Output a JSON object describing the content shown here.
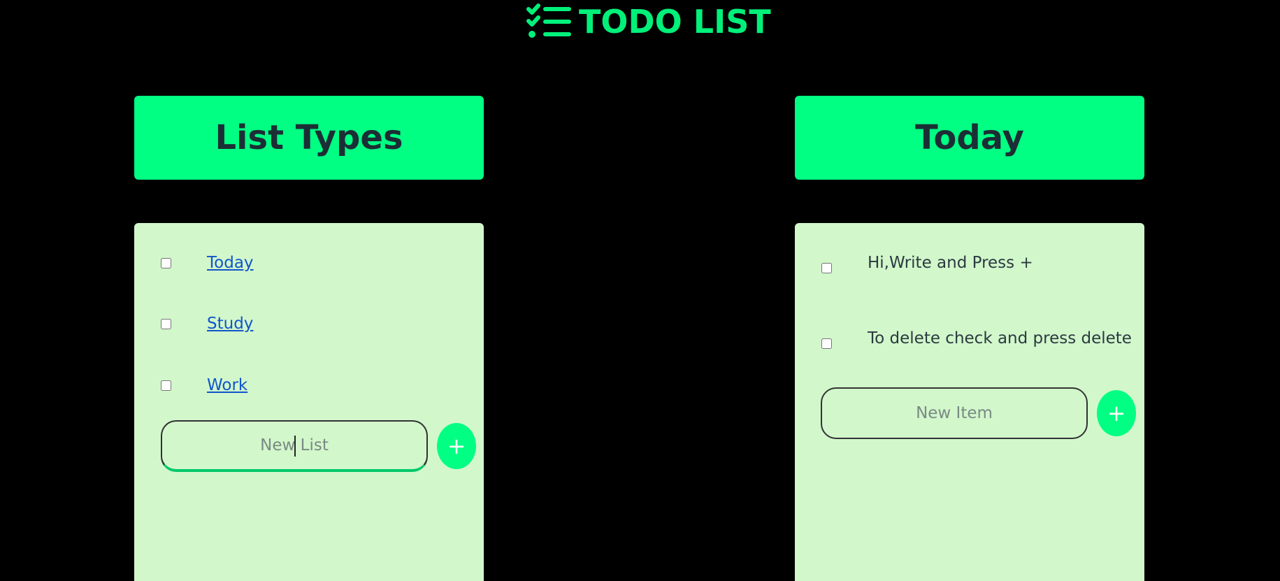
{
  "app": {
    "title": "TODO LIST",
    "brand_icon": "checklist-icon",
    "accent_color": "#00ff83",
    "background_color": "#000000",
    "panel_color": "#d2f7cb"
  },
  "list_types": {
    "heading": "List Types",
    "items": [
      {
        "label": "Today",
        "checked": false
      },
      {
        "label": "Study",
        "checked": false
      },
      {
        "label": "Work",
        "checked": false
      }
    ],
    "new_input": {
      "value": "",
      "placeholder": "New List"
    },
    "add_button_label": "+"
  },
  "current_list": {
    "heading": "Today",
    "items": [
      {
        "label": "Hi,Write and Press +",
        "checked": false
      },
      {
        "label": "To delete check and press delete",
        "checked": false
      }
    ],
    "new_input": {
      "value": "",
      "placeholder": "New Item"
    },
    "add_button_label": "+"
  }
}
